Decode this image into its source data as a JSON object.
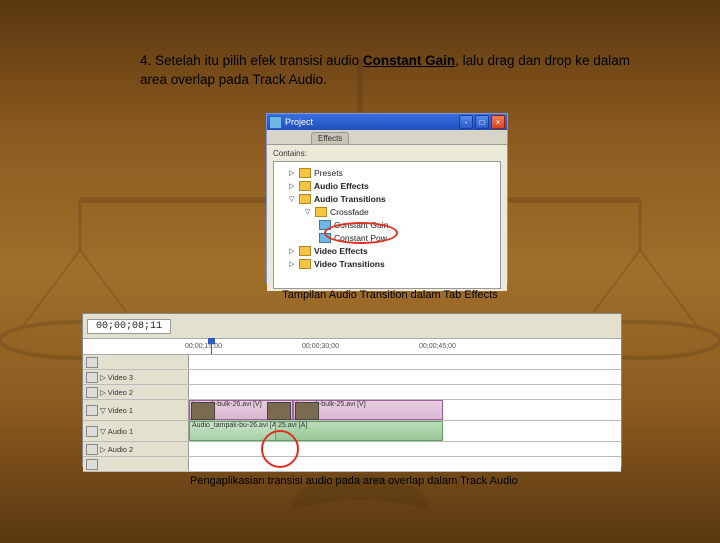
{
  "instruction": {
    "number": "4.",
    "part1": "Setelah itu pilih efek transisi audio ",
    "bold": "Constant Gain",
    "part2": ", lalu drag dan drop ke dalam area overlap pada Track Audio."
  },
  "shot1": {
    "title": "Project",
    "tab": "Effects",
    "label": "Contains:",
    "tree": [
      "Presets",
      "Audio Effects",
      "Audio Transitions",
      "Crossfade",
      "Constant Gain",
      "Constant Pow",
      "Video Effects",
      "Video Transitions"
    ]
  },
  "caption1": "Tampilan Audio Transition dalam Tab Effects",
  "shot2": {
    "timecode": "00;00;08;11",
    "ticks": [
      "00;00;15;00",
      "00;00;30;00",
      "00;00;45;00"
    ],
    "tracks": {
      "v3": "Video 3",
      "v2": "Video 2",
      "v1": "Video 1",
      "a1": "Audio 1",
      "a2": "Audio 2"
    },
    "clips": {
      "c1": "tampak-bulk-26.avi [V]",
      "c2": "tampak-bulk-25.avi [V]",
      "c3": "Audio_tampak-bu-26.avi [A]",
      "c4": "25.avi [A]"
    }
  },
  "caption2": "Pengaplikasian transisi audio pada area overlap dalam Track Audio"
}
